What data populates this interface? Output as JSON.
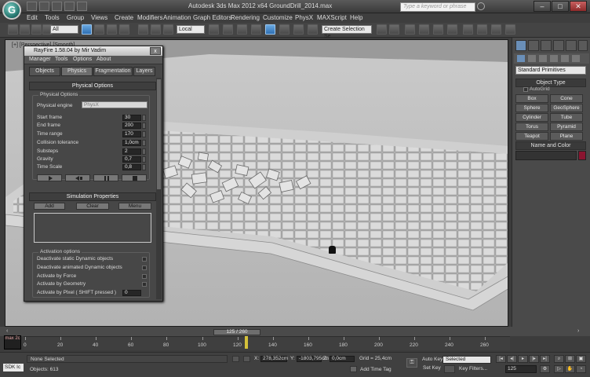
{
  "app": {
    "logo_letter": "G",
    "title": "Autodesk 3ds Max  2012 x64       GroundDrill_2014.max",
    "search_placeholder": "Type a keyword or phrase",
    "win_min": "–",
    "win_max": "□",
    "win_close": "✕"
  },
  "menu": [
    "Edit",
    "Tools",
    "Group",
    "Views",
    "Create",
    "Modifiers",
    "Animation",
    "Graph Editors",
    "Rendering",
    "Customize",
    "PhysX",
    "MAXScript",
    "Help"
  ],
  "toolbar": {
    "selection_filter": "All",
    "coord_system": "Local",
    "selection_set_placeholder": "Create Selection Se"
  },
  "viewport": {
    "label": "[+] [Perspective] [Smooth]"
  },
  "command_panel": {
    "dropdown": "Standard Primitives",
    "object_type_header": "Object Type",
    "autogrid_label": "AutoGrid",
    "buttons": [
      "Box",
      "Cone",
      "Sphere",
      "GeoSphere",
      "Cylinder",
      "Tube",
      "Torus",
      "Pyramid",
      "Teapot",
      "Plane"
    ],
    "name_color_header": "Name and Color",
    "color": "#8a1530"
  },
  "rayfire": {
    "title": "RayFire 1.58.04  by Mir Vadim",
    "close": "x",
    "menu": [
      "Manager",
      "Tools",
      "Options",
      "About"
    ],
    "tabs": [
      "Objects",
      "Physics",
      "Fragmentation",
      "Layers"
    ],
    "physical_section": "Physical Options",
    "physical_group": "Physical Options",
    "engine_label": "Physical engine",
    "engine_value": "PhysX",
    "rows": [
      {
        "label": "Start frame",
        "value": "30"
      },
      {
        "label": "End frame",
        "value": "200"
      },
      {
        "label": "Time range",
        "value": "170"
      },
      {
        "label": "Collision tolerance",
        "value": "1,0cm"
      },
      {
        "label": "Substeps",
        "value": "2"
      },
      {
        "label": "Gravity",
        "value": "0,7"
      },
      {
        "label": "Time Scale",
        "value": "0,8"
      }
    ],
    "sim_section": "Simulation Properties",
    "sim_buttons": [
      "Add",
      "Clear",
      "Menu"
    ],
    "activation_group": "Activation options",
    "activation_items": [
      "Deactivate static Dynamic objects",
      "Deactivate animated Dynamic objects",
      "Activate by Force",
      "Activate by Geometry",
      "Activate by Plxel ( SHIFT pressed )"
    ],
    "activation_value": "0"
  },
  "timeline": {
    "slider": "125 / 260",
    "ticks": [
      "0",
      "20",
      "40",
      "60",
      "80",
      "100",
      "120",
      "140",
      "160",
      "180",
      "200",
      "220",
      "240",
      "260"
    ],
    "max_label": "max 2c"
  },
  "status": {
    "mini_listener": "SDK Ic",
    "selection": "None Selected",
    "objects": "Objects: 613",
    "x_label": "X:",
    "x_value": "278,352cm",
    "y_label": "Y:",
    "y_value": "-1803,795cm",
    "z_label": "Z:",
    "z_value": "0,0cm",
    "grid": "Grid = 25,4cm",
    "add_time_tag": "Add Time Tag",
    "auto_key": "Auto Key",
    "set_key": "Set Key",
    "selected": "Selected",
    "key_filters": "Key Filters...",
    "frame": "125"
  }
}
